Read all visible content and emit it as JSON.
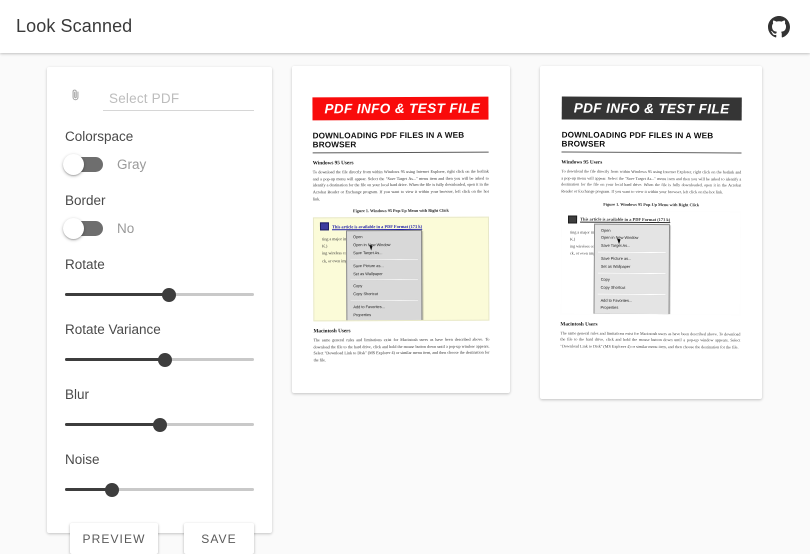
{
  "app": {
    "title": "Look Scanned",
    "github_icon": "github-icon"
  },
  "controls": {
    "file_picker": {
      "icon": "paperclip-icon",
      "placeholder": "Select PDF",
      "value": ""
    },
    "fields": [
      {
        "label": "Colorspace",
        "type": "toggle",
        "value": "Gray",
        "on": false
      },
      {
        "label": "Border",
        "type": "toggle",
        "value": "No",
        "on": false
      },
      {
        "label": "Rotate",
        "type": "slider",
        "percent": 55
      },
      {
        "label": "Rotate Variance",
        "type": "slider",
        "percent": 53
      },
      {
        "label": "Blur",
        "type": "slider",
        "percent": 50
      },
      {
        "label": "Noise",
        "type": "slider",
        "percent": 25
      }
    ],
    "preview_button": "PREVIEW",
    "save_button": "SAVE"
  },
  "colors": {
    "banner_red": "#f90b0b",
    "banner_gray": "#3a3a3a",
    "slider_fill": "#3d3d3d",
    "slider_track": "#c9c9c9",
    "switch_track": "#6e6e6e",
    "page_background": "#fafafa",
    "highlight_yellow": "#fbfbd8"
  },
  "document": {
    "banner": "PDF INFO & TEST FILE",
    "heading": "DOWNLOADING PDF FILES IN A WEB BROWSER",
    "section1_title": "Windows 95 Users",
    "section1_body": "To download the file directly from within Windows 95 using Internet Explorer, right click on the hotlink and a pop-up menu will appear. Select the \"Save Target As...\" menu item and then you will be asked to identify a destination for the file on your local hard drive. When the file is fully downloaded, open it in the Acrobat Reader or Exchange program. If you want to view it within your browser, left click on the hot link.",
    "figure_caption": "Figure 1. Windows 95 Pop-Up Menu with Right Click",
    "figure_link": "This article is available in a PDF Format (173 k)",
    "figure_lines": [
      "ting a major impact on how",
      "K.)",
      "ing wireless communication",
      "ck, or even impossible, to al"
    ],
    "context_menu": [
      "Open",
      "Open in New Window",
      "Save Target As...",
      "Save Picture as...",
      "Set as Wallpaper",
      "Copy",
      "Copy Shortcut",
      "Add to Favorites...",
      "Properties"
    ],
    "section2_title": "Macintosh Users",
    "section2_body": "The same general rules and limitations exist for Macintosh users as have been described above. To download the file to the hard drive, click and hold the mouse button down until a pop-up window appears. Select \"Download Link to Disk\" (MS Explorer 4) or similar menu item, and then choose the destination for the file."
  },
  "previews": [
    {
      "name": "preview-color",
      "colorspace": "color"
    },
    {
      "name": "preview-gray",
      "colorspace": "gray"
    }
  ]
}
